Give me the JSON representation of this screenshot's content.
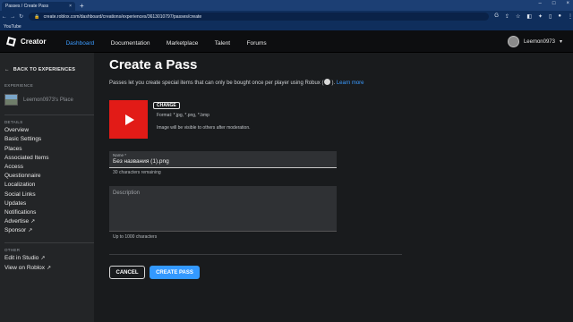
{
  "browser": {
    "tab_title": "Passes / Create Pass",
    "tab_close": "×",
    "new_tab": "+",
    "url": "create.roblox.com/dashboard/creations/experiences/3613010797/passes/create",
    "bookmark": "YouTube",
    "window_controls": [
      "–",
      "□",
      "×"
    ]
  },
  "header": {
    "brand": "Creator",
    "nav": [
      "Dashboard",
      "Documentation",
      "Marketplace",
      "Talent",
      "Forums"
    ],
    "active_nav": "Dashboard",
    "username": "Leemon0973",
    "user_chevron": "▾"
  },
  "sidebar": {
    "back": "BACK TO EXPERIENCES",
    "experience_label": "EXPERIENCE",
    "experience_name": "Leemon0973's Place",
    "details_label": "DETAILS",
    "details": [
      "Overview",
      "Basic Settings",
      "Places",
      "Associated Items",
      "Access",
      "Questionnaire",
      "Localization",
      "Social Links",
      "Updates",
      "Notifications",
      "Advertise",
      "Sponsor"
    ],
    "other_label": "OTHER",
    "other": [
      "Edit in Studio",
      "View on Roblox"
    ]
  },
  "main": {
    "title": "Create a Pass",
    "description_prefix": "Passes let you create special items that can only be bought once per player using Robux (",
    "description_suffix": ").",
    "learn_more": "Learn more",
    "change_button": "CHANGE",
    "formats": "Format: *.jpg, *.png, *.bmp",
    "moderation_note": "Image will be visible to others after moderation.",
    "name_label": "Name *",
    "name_value": "Без названия (1).png",
    "name_remaining": "30 characters remaining",
    "description_placeholder": "Description",
    "description_limit": "Up to 1000 characters",
    "cancel_button": "CANCEL",
    "create_button": "CREATE PASS"
  },
  "colors": {
    "accent": "#3399ff",
    "youtube_red": "#e21b17",
    "browser_blue": "#1c3f74"
  }
}
